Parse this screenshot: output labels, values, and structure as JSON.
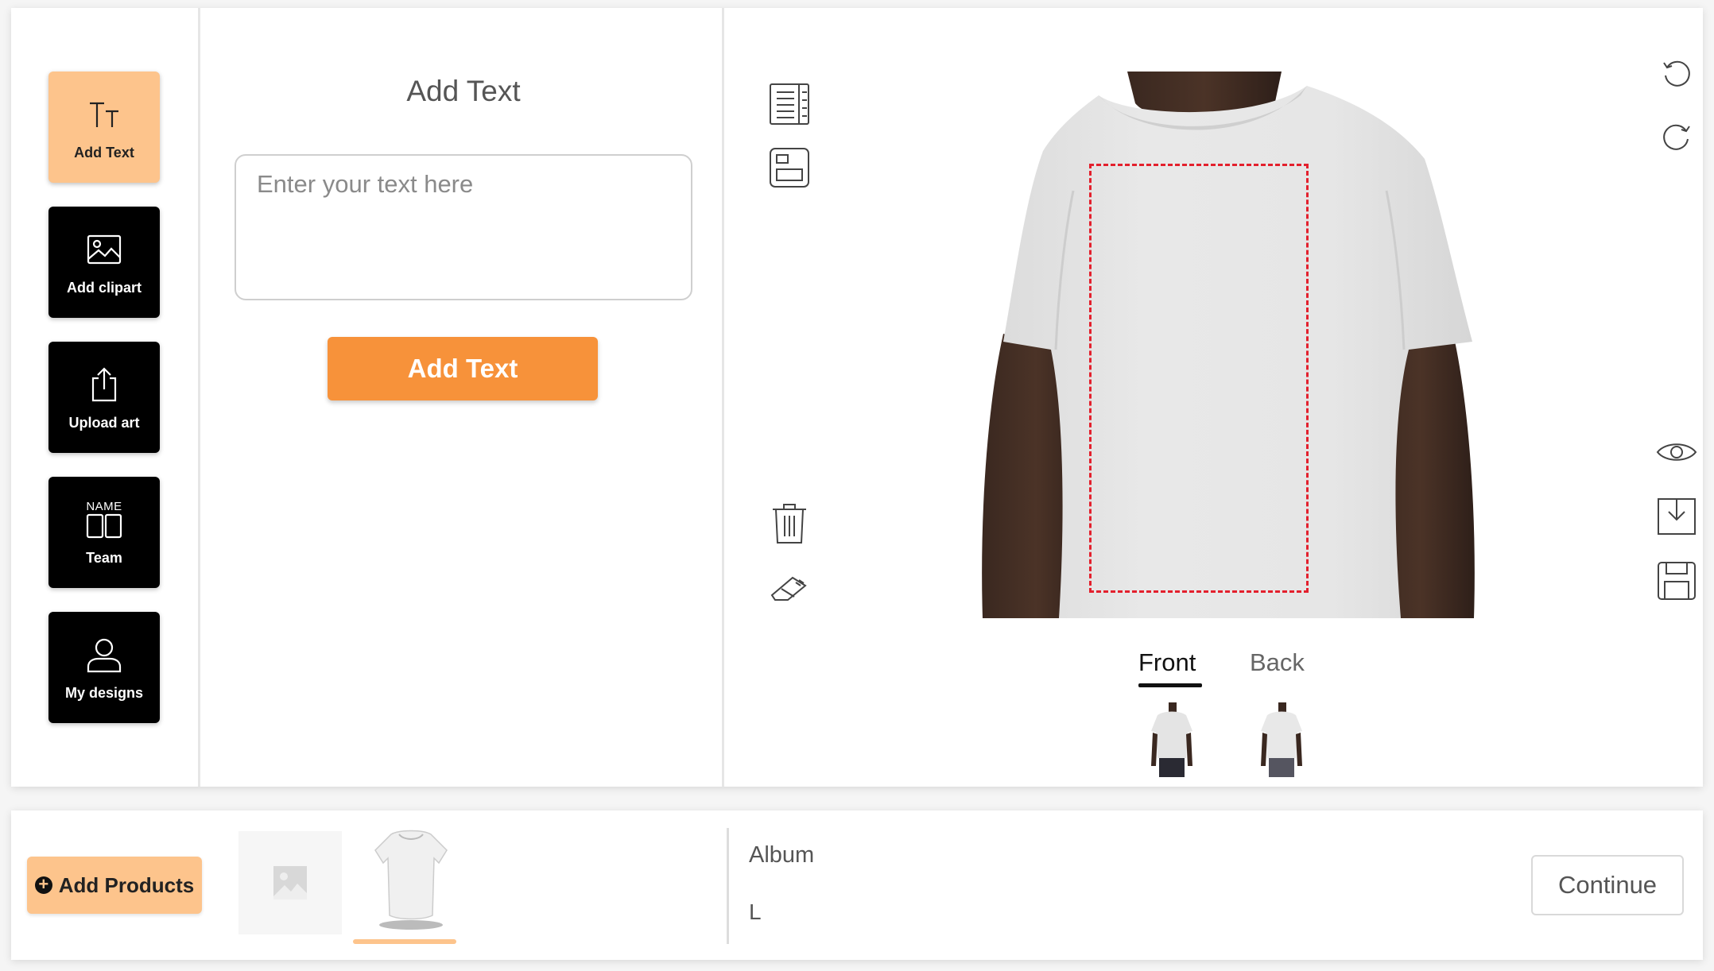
{
  "sidebar": {
    "tools": [
      {
        "label": "Add Text",
        "icon": "text-size-icon",
        "active": true
      },
      {
        "label": "Add clipart",
        "icon": "image-icon",
        "active": false
      },
      {
        "label": "Upload art",
        "icon": "upload-icon",
        "active": false
      },
      {
        "label": "Team",
        "icon": "team-name-icon",
        "active": false,
        "icon_text": "NAME"
      },
      {
        "label": "My designs",
        "icon": "user-icon",
        "active": false
      }
    ]
  },
  "text_panel": {
    "title": "Add Text",
    "input_placeholder": "Enter your text here",
    "input_value": "",
    "button_label": "Add Text"
  },
  "canvas": {
    "left_tools": [
      "layers-icon",
      "layout-icon",
      "trash-icon",
      "eraser-icon"
    ],
    "right_tools": [
      "undo-icon",
      "redo-icon",
      "eye-icon",
      "download-icon",
      "save-icon"
    ],
    "views": [
      {
        "label": "Front",
        "active": true
      },
      {
        "label": "Back",
        "active": false
      }
    ]
  },
  "bottom_bar": {
    "add_products_label": "Add Products",
    "album_label": "Album",
    "size_label": "L",
    "continue_label": "Continue"
  },
  "colors": {
    "accent_orange": "#f7923a",
    "accent_peach": "#fdc48c",
    "print_area_red": "#e3202d",
    "tool_black": "#000000"
  }
}
